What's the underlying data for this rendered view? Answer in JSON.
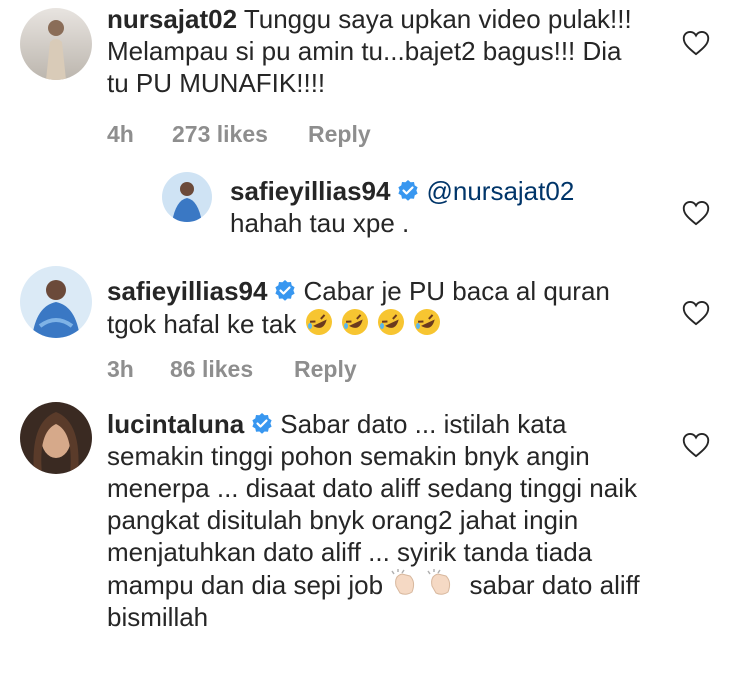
{
  "comments": [
    {
      "username": "nursajat02",
      "text": "Tunggu saya upkan video pulak!!! Melampau si pu amin tu...bajet2 bagus!!! Dia tu PU MUNAFIK!!!!",
      "time": "4h",
      "likes": "273 likes",
      "reply": "Reply"
    },
    {
      "username": "safieyillias94",
      "verified": true,
      "mention": "@nursajat02",
      "text": "hahah tau xpe ."
    },
    {
      "username": "safieyillias94",
      "verified": true,
      "text": "Cabar je PU baca al quran tgok hafal ke tak",
      "emojis": [
        "rofl-emoji",
        "rofl-emoji",
        "rofl-emoji",
        "rofl-emoji"
      ],
      "time": "3h",
      "likes": "86 likes",
      "reply": "Reply"
    },
    {
      "username": "lucintaluna",
      "verified": true,
      "text_a": "Sabar dato ... istilah kata semakin tinggi pohon semakin bnyk angin menerpa ... disaat dato aliff sedang tinggi naik pangkat disitulah bnyk orang2 jahat ingin menjatuhkan dato aliff ... syirik tanda tiada mampu dan dia sepi job",
      "emojis": [
        "clapping-hands-emoji",
        "clapping-hands-emoji"
      ],
      "text_b": "sabar dato aliff bismillah"
    }
  ],
  "icons": {
    "like": "heart-outline-icon",
    "verified": "verified-badge-icon"
  },
  "colors": {
    "text": "#262626",
    "muted": "#8e8e8e",
    "mention": "#003569",
    "verified": "#3897f0"
  }
}
